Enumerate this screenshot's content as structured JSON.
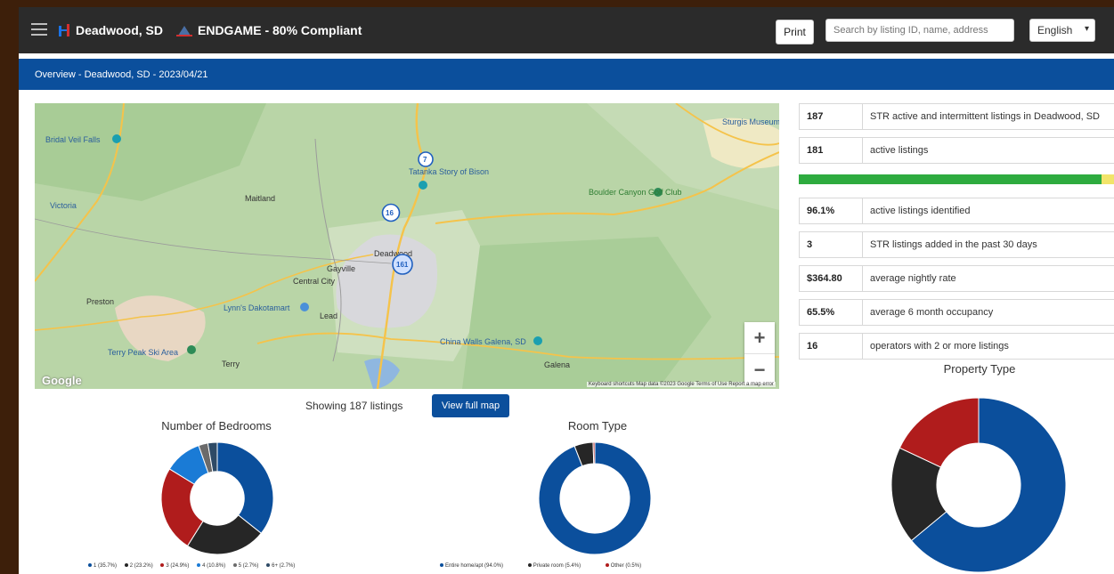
{
  "header": {
    "city": "Deadwood, SD",
    "product": "ENDGAME - 80% Compliant",
    "print_label": "Print",
    "search_placeholder": "Search by listing ID, name, address",
    "language": "English"
  },
  "breadcrumb": "Overview - Deadwood, SD - 2023/04/21",
  "map": {
    "labels": [
      "Bridal Veil Falls",
      "Victoria",
      "Maitland",
      "Preston",
      "Terry Peak Ski Area",
      "Terry",
      "Gayville",
      "Central City",
      "Lead",
      "Deadwood",
      "Lynn's Dakotamart",
      "Tatanka Story of Bison",
      "Boulder Canyon Golf Club",
      "China Walls Galena, SD",
      "Galena",
      "Sturgis Museum & Ha"
    ],
    "clusters": [
      "7",
      "16",
      "161"
    ],
    "google_mark": "Google",
    "footer": "Keyboard shortcuts   Map data ©2023 Google   Terms of Use   Report a map error",
    "zoom_in": "+",
    "zoom_out": "−"
  },
  "showing_text": "Showing 187 listings",
  "view_map_label": "View full map",
  "stats": [
    {
      "value": "187",
      "label": "STR active and intermittent listings in Deadwood, SD"
    },
    {
      "value": "181",
      "label": "active listings"
    },
    {
      "value": "96.1%",
      "label": "active listings identified"
    },
    {
      "value": "3",
      "label": "STR listings added in the past 30 days"
    },
    {
      "value": "$364.80",
      "label": "average nightly rate"
    },
    {
      "value": "65.5%",
      "label": "average 6 month occupancy"
    },
    {
      "value": "16",
      "label": "operators with 2 or more listings"
    }
  ],
  "identified_progress": {
    "identified_pct": 96.1
  },
  "colors": {
    "blue": "#0b4f9c",
    "dark": "#262626",
    "red": "#b01c1c",
    "light_blue": "#1a7bd6",
    "gray": "#6b6b6b",
    "slate": "#2e4a66",
    "green": "#2eab3f",
    "yellow": "#f2e46a"
  },
  "chart_data": [
    {
      "type": "pie",
      "title": "Number of Bedrooms",
      "categories": [
        "1",
        "2",
        "3",
        "4",
        "5",
        "6+"
      ],
      "values": [
        35.7,
        23.2,
        24.9,
        10.8,
        2.7,
        2.7
      ],
      "legend": [
        "1 (35.7%)",
        "2 (23.2%)",
        "3 (24.9%)",
        "4 (10.8%)",
        "5 (2.7%)",
        "6+ (2.7%)"
      ],
      "donut": true
    },
    {
      "type": "pie",
      "title": "Room Type",
      "categories": [
        "Entire home/apt",
        "Private room",
        "Other"
      ],
      "values": [
        94.0,
        5.4,
        0.5
      ],
      "legend": [
        "Entire home/apt (94.0%)",
        "Private room (5.4%)",
        "Other (0.5%)"
      ],
      "donut": true
    },
    {
      "type": "pie",
      "title": "Property Type",
      "values": [
        64,
        18,
        18
      ],
      "donut": true
    }
  ]
}
